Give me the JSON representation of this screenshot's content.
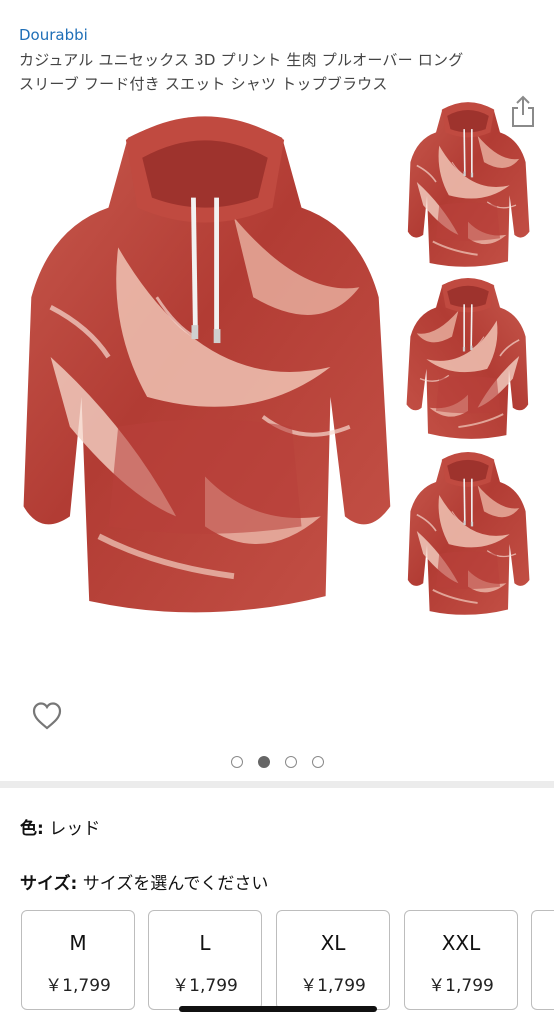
{
  "product": {
    "brand": "Dourabbi",
    "title_line1": "カジュアル ユニセックス 3D プリント 生肉 プルオーバー ロング",
    "title_line2": "スリーブ フード付き スエット シャツ トップブラウス"
  },
  "gallery": {
    "page_count": 4,
    "active_index": 1
  },
  "icons": {
    "share": "share-icon",
    "favorite": "heart-icon"
  },
  "options": {
    "color_label": "色:",
    "color_value": "レッド",
    "size_label": "サイズ:",
    "size_value": "サイズを選んでください",
    "sizes": [
      {
        "name": "M",
        "price": "￥1,799"
      },
      {
        "name": "L",
        "price": "￥1,799"
      },
      {
        "name": "XL",
        "price": "￥1,799"
      },
      {
        "name": "XXL",
        "price": "￥1,799"
      }
    ]
  },
  "colors": {
    "brand_link": "#1f6fb7",
    "meat_red": "#b8423a",
    "fat_pink": "#f2c6b6"
  }
}
